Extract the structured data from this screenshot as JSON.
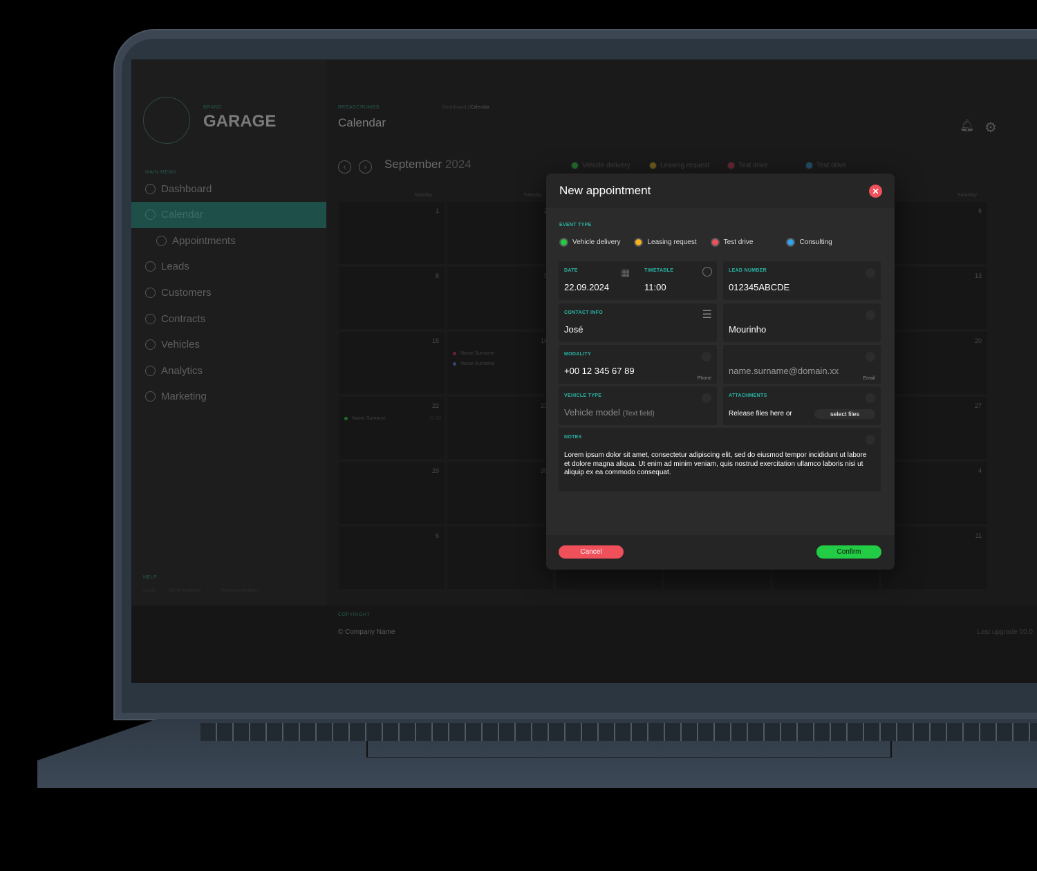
{
  "app": {
    "brand_label": "BRAND",
    "brand": "GARAGE"
  },
  "sidebar": {
    "menu_label": "MAIN MENU",
    "items": [
      {
        "label": "Dashboard"
      },
      {
        "label": "Calendar",
        "active": true
      },
      {
        "label": "Appointments",
        "sub": true
      },
      {
        "label": "Leads"
      },
      {
        "label": "Customers"
      },
      {
        "label": "Contracts"
      },
      {
        "label": "Vehicles"
      },
      {
        "label": "Analytics"
      },
      {
        "label": "Marketing"
      }
    ],
    "help_label": "HELP",
    "help_items": [
      "Guide",
      "Send feedback",
      "Report a problem"
    ]
  },
  "header": {
    "breadcrumbs_label": "BREADCRUMBS",
    "title": "Calendar",
    "breadcrumb": [
      "Dashboard",
      "Calendar"
    ],
    "icons": [
      "bell-icon",
      "gear-icon"
    ]
  },
  "calendar": {
    "month": "September",
    "year": "2024",
    "legend": [
      {
        "label": "Vehicle delivery",
        "color": "#1f6b2c"
      },
      {
        "label": "Leasing request",
        "color": "#6b5a1a"
      },
      {
        "label": "Test drive",
        "color": "#6b2230"
      },
      {
        "label": "Test drive",
        "color": "#1f4d6b"
      }
    ],
    "weekdays": [
      "Monday",
      "Tuesday",
      "",
      "",
      "",
      "Saturday"
    ],
    "weeks": [
      [
        "1",
        "2",
        "",
        "",
        "",
        "6"
      ],
      [
        "8",
        "9",
        "",
        "",
        "",
        "13"
      ],
      [
        "15",
        "16",
        "",
        "",
        "",
        "20"
      ],
      [
        "22",
        "23",
        "",
        "",
        "",
        "27"
      ],
      [
        "29",
        "30",
        "",
        "",
        "",
        "4"
      ],
      [
        "6",
        "",
        "",
        "",
        "",
        "11"
      ]
    ],
    "events": [
      {
        "week": 2,
        "day": 1,
        "name": "Name Surname",
        "color": "#6b2230"
      },
      {
        "week": 2,
        "day": 1,
        "name": "Name Surname",
        "color": "#2d4a6b"
      },
      {
        "week": 3,
        "day": 0,
        "name": "Name Surname",
        "time": "11:00",
        "color": "#1f6b2c"
      }
    ]
  },
  "footer": {
    "copyright_label": "COPYRIGHT",
    "copyright": "© Company Name",
    "last_upgrade": "Last upgrade 00.0"
  },
  "modal": {
    "title": "New appointment",
    "event_type_label": "EVENT TYPE",
    "event_types": [
      {
        "label": "Vehicle delivery",
        "color": "#22cc44"
      },
      {
        "label": "Leasing request",
        "color": "#f5b21c"
      },
      {
        "label": "Test drive",
        "color": "#f0505a"
      },
      {
        "label": "Consulting",
        "color": "#2fa3f0"
      }
    ],
    "date_label": "DATE",
    "date": "22.09.2024",
    "timetable_label": "TIMETABLE",
    "time": "11:00",
    "lead_label": "LEAD NUMBER",
    "lead": "012345ABCDE",
    "contact_label": "CONTACT INFO",
    "first_name": "José",
    "last_name": "Mourinho",
    "modality_label": "MODALITY",
    "phone": "+00 12 345 67 89",
    "phone_hint": "Phone",
    "email": "name.surname@domain.xx",
    "email_hint": "Email",
    "vehicle_label": "VEHICLE TYPE",
    "vehicle_placeholder": "Vehicle model",
    "vehicle_placeholder_note": "(Text field)",
    "attachments_label": "ATTACHMENTS",
    "attachments_text": "Release files here or",
    "select_files": "select files",
    "notes_label": "NOTES",
    "notes": "Lorem ipsum dolor sit amet, consectetur adipiscing elit, sed do eiusmod tempor incididunt ut labore et dolore magna aliqua. Ut enim ad minim veniam, quis nostrud exercitation ullamco laboris nisi ut aliquip ex ea commodo consequat.",
    "cancel": "Cancel",
    "confirm": "Confirm",
    "cancel_color": "#f0505a",
    "confirm_color": "#22cc44"
  }
}
